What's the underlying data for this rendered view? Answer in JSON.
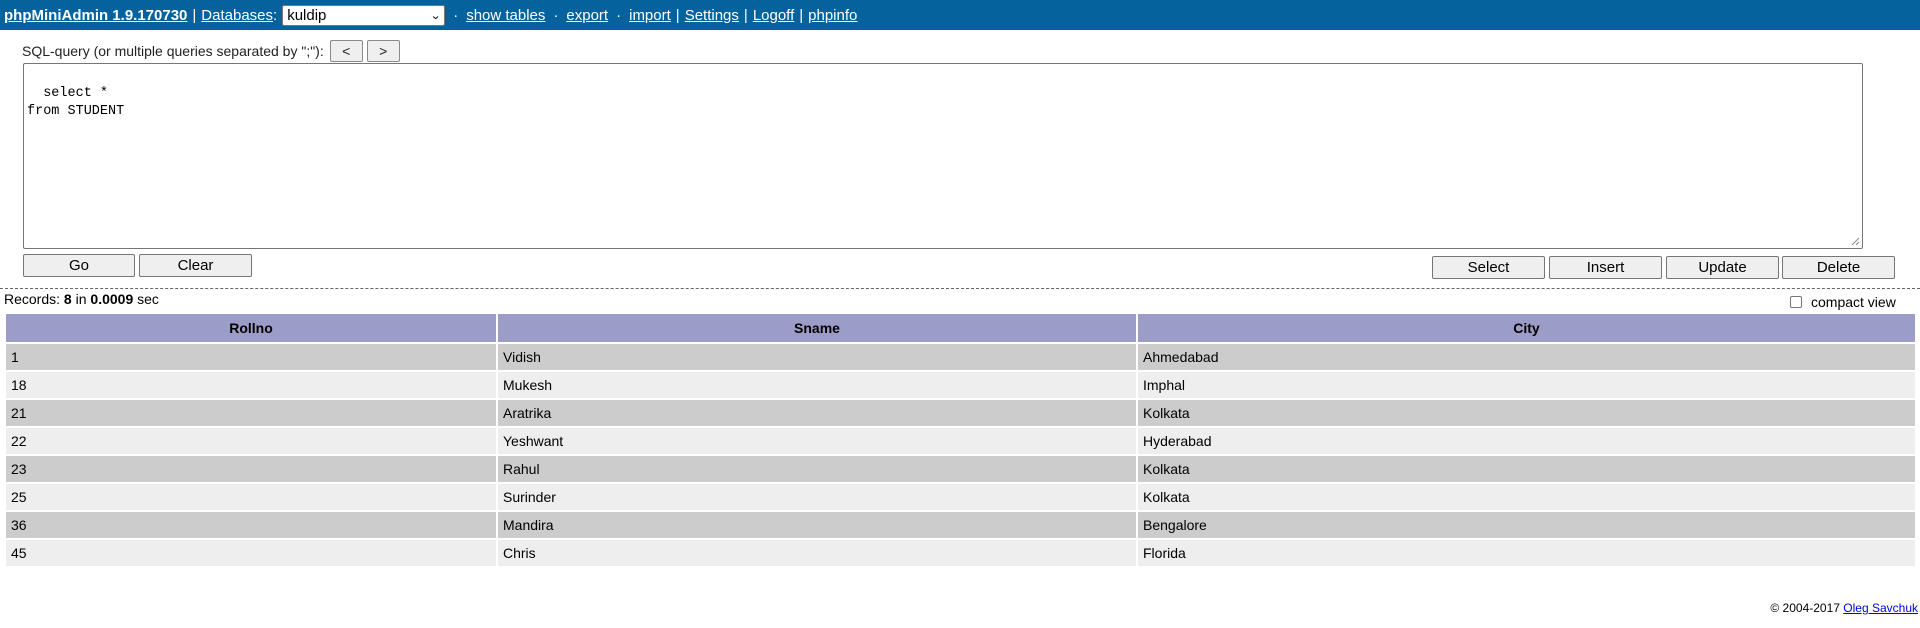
{
  "topbar": {
    "brand": "phpMiniAdmin 1.9.170730",
    "databases_label": "Databases",
    "database_selected": "kuldip",
    "links": [
      "show tables",
      "export",
      "import",
      "Settings",
      "Logoff",
      "phpinfo"
    ]
  },
  "query": {
    "label": "SQL-query (or multiple queries separated by \";\"):",
    "prev_label": "<",
    "next_label": ">",
    "text": "select *\nfrom STUDENT"
  },
  "buttons": {
    "go": "Go",
    "clear": "Clear",
    "select": "Select",
    "insert": "Insert",
    "update": "Update",
    "delete": "Delete"
  },
  "records": {
    "prefix": "Records:",
    "count": "8",
    "in": "in",
    "time": "0.0009",
    "unit": "sec"
  },
  "compact_view": {
    "label": "compact view",
    "checked": false
  },
  "table": {
    "columns": [
      "Rollno",
      "Sname",
      "City"
    ],
    "rows": [
      [
        "1",
        "Vidish",
        "Ahmedabad"
      ],
      [
        "18",
        "Mukesh",
        "Imphal"
      ],
      [
        "21",
        "Aratrika",
        "Kolkata"
      ],
      [
        "22",
        "Yeshwant",
        "Hyderabad"
      ],
      [
        "23",
        "Rahul",
        "Kolkata"
      ],
      [
        "25",
        "Surinder",
        "Kolkata"
      ],
      [
        "36",
        "Mandira",
        "Bengalore"
      ],
      [
        "45",
        "Chris",
        "Florida"
      ]
    ]
  },
  "footer": {
    "copyright": "© 2004-2017",
    "author": "Oleg Savchuk"
  },
  "colors": {
    "topbar": "#06629c",
    "header": "#9c9cc9",
    "row_odd": "#cccccc",
    "row_even": "#eeeeee"
  }
}
